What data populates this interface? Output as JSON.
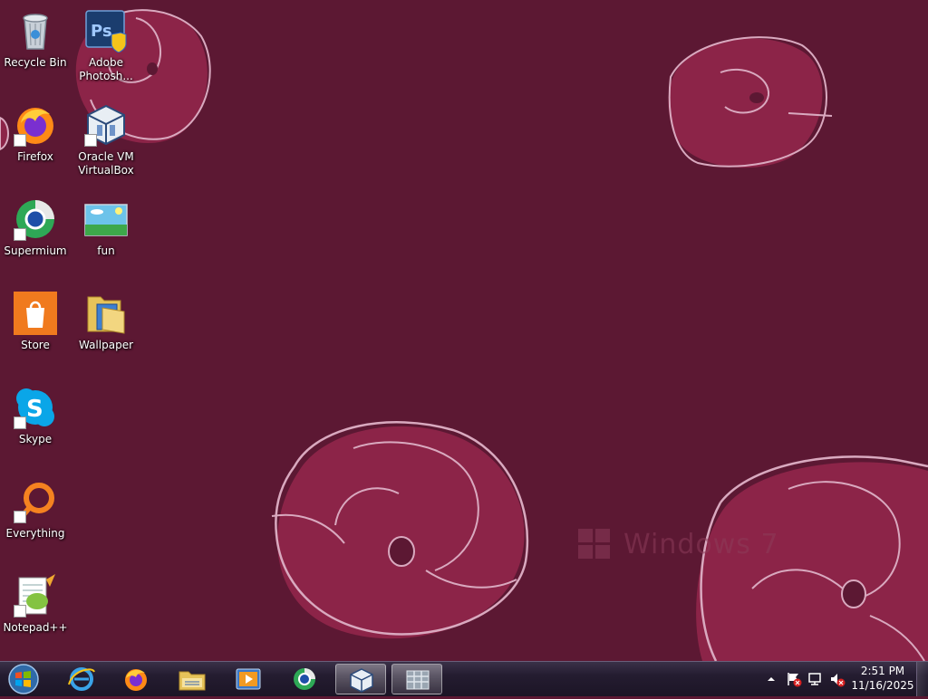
{
  "desktop": {
    "watermark": "Windows 7",
    "icons": [
      {
        "label": "Recycle Bin",
        "icon": "recycle-bin-icon",
        "shortcut": false
      },
      {
        "label": "Adobe Photosh...",
        "icon": "photoshop-icon",
        "shortcut": false
      },
      {
        "label": "Firefox",
        "icon": "firefox-icon",
        "shortcut": true
      },
      {
        "label": "Oracle VM VirtualBox",
        "icon": "virtualbox-icon",
        "shortcut": true
      },
      {
        "label": "Supermium",
        "icon": "supermium-icon",
        "shortcut": true
      },
      {
        "label": "fun",
        "icon": "image-file-icon",
        "shortcut": false
      },
      {
        "label": "Store",
        "icon": "store-icon",
        "shortcut": false
      },
      {
        "label": "Wallpaper",
        "icon": "folder-icon",
        "shortcut": false
      },
      {
        "label": "Skype",
        "icon": "skype-icon",
        "shortcut": true
      },
      {
        "label": "Everything",
        "icon": "everything-icon",
        "shortcut": true
      },
      {
        "label": "Notepad++",
        "icon": "notepadpp-icon",
        "shortcut": true
      }
    ]
  },
  "taskbar": {
    "start": "start-orb-icon",
    "pinned": [
      {
        "name": "internet-explorer-icon",
        "active": false
      },
      {
        "name": "firefox-icon",
        "active": false
      },
      {
        "name": "file-explorer-icon",
        "active": false
      },
      {
        "name": "media-player-icon",
        "active": false
      },
      {
        "name": "supermium-icon",
        "active": false
      },
      {
        "name": "virtualbox-icon",
        "active": true
      },
      {
        "name": "app-window-icon",
        "active": true
      }
    ],
    "tray_icons": [
      "show-hidden-icons-chevron",
      "action-center-flag-icon",
      "network-icon",
      "volume-muted-icon"
    ],
    "clock": {
      "time": "2:51 PM",
      "date": "11/16/2025"
    }
  },
  "colors": {
    "background": "#5c1833",
    "flower": "#8c2448",
    "flower_outline": "#d9a9bf",
    "taskbar": "#241c30"
  }
}
